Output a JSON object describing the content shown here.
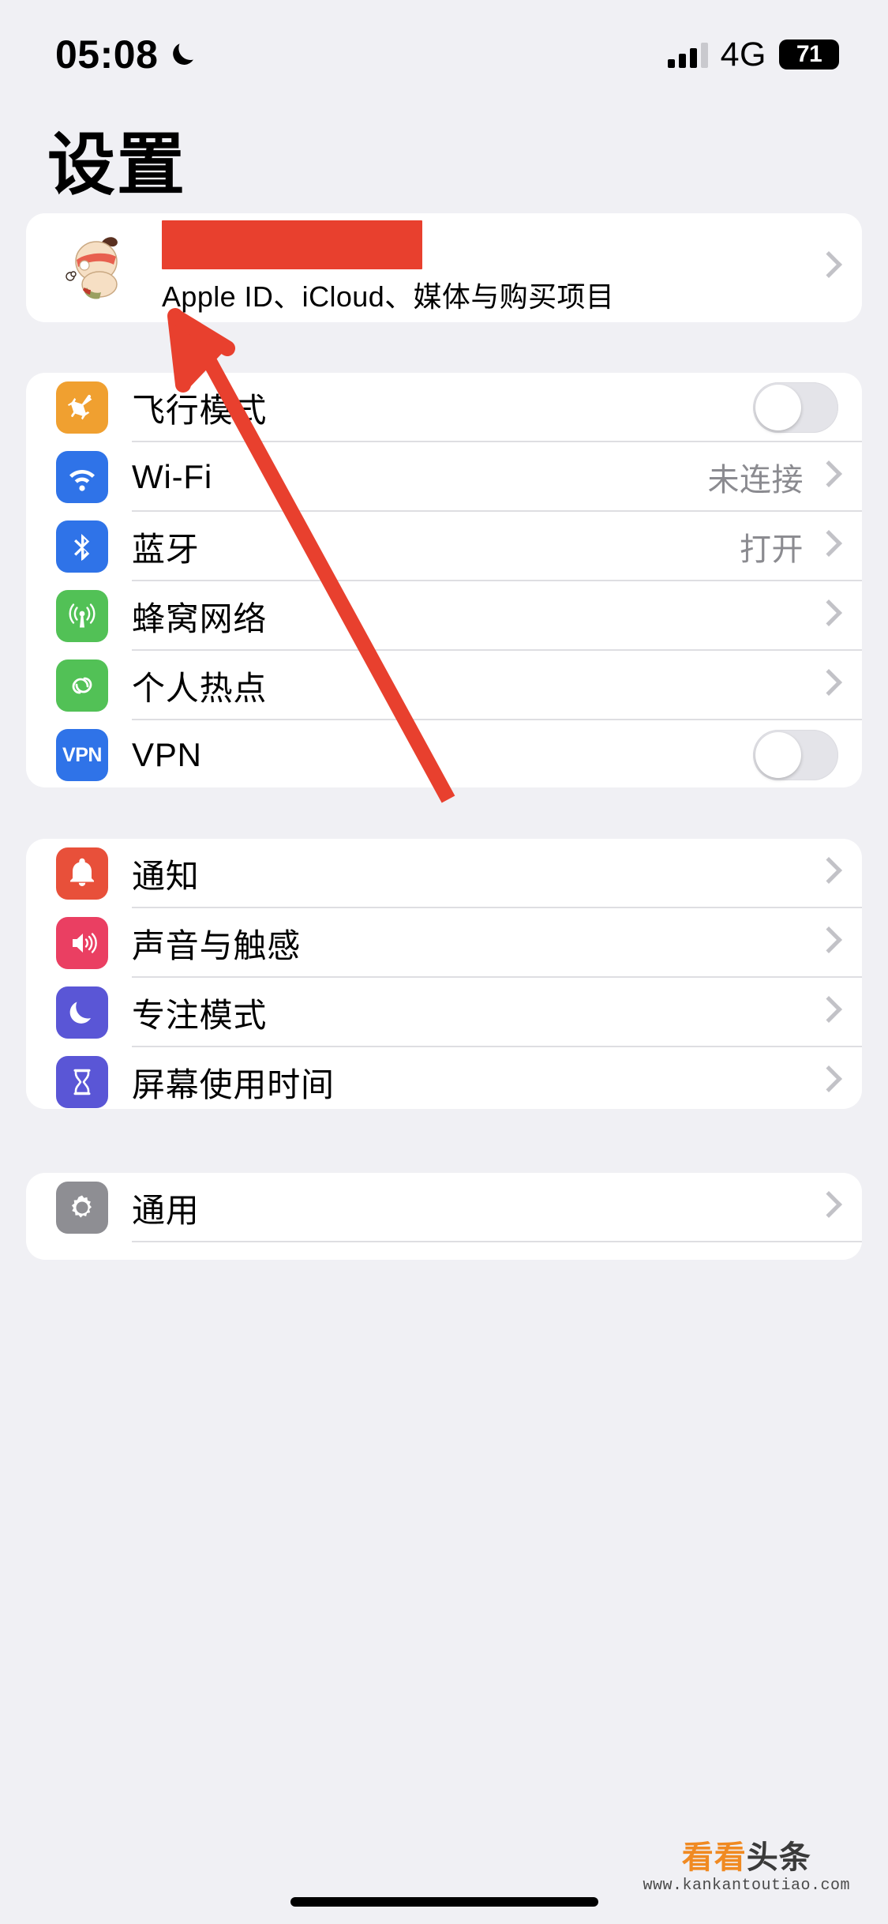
{
  "status_bar": {
    "time": "05:08",
    "dnd_icon": "crescent-moon-icon",
    "network_type": "4G",
    "battery_level": "71",
    "signal_icon": "cellular-signal-icon"
  },
  "header": {
    "title": "设置"
  },
  "account": {
    "avatar_icon": "user-avatar-cartoon",
    "name_redacted": true,
    "subtitle": "Apple ID、iCloud、媒体与购买项目",
    "chevron_icon": "chevron-right-icon"
  },
  "groups": [
    {
      "id": "connectivity",
      "rows": [
        {
          "label": "飞行模式",
          "icon": "airplane-icon",
          "icon_color": "#f0a030",
          "control": "toggle",
          "toggle_on": false,
          "value": ""
        },
        {
          "label": "Wi-Fi",
          "icon": "wifi-icon",
          "icon_color": "#2f73e8",
          "control": "chevron",
          "value": "未连接"
        },
        {
          "label": "蓝牙",
          "icon": "bluetooth-icon",
          "icon_color": "#2f73e8",
          "control": "chevron",
          "value": "打开"
        },
        {
          "label": "蜂窝网络",
          "icon": "cellular-antenna-icon",
          "icon_color": "#52c156",
          "control": "chevron",
          "value": ""
        },
        {
          "label": "个人热点",
          "icon": "hotspot-link-icon",
          "icon_color": "#52c156",
          "control": "chevron",
          "value": ""
        },
        {
          "label": "VPN",
          "icon": "vpn-icon",
          "icon_color": "#2f73e8",
          "control": "toggle",
          "toggle_on": false,
          "value": ""
        }
      ]
    },
    {
      "id": "alerts",
      "rows": [
        {
          "label": "通知",
          "icon": "bell-icon",
          "icon_color": "#e8503a",
          "control": "chevron",
          "value": ""
        },
        {
          "label": "声音与触感",
          "icon": "speaker-waves-icon",
          "icon_color": "#ea3f62",
          "control": "chevron",
          "value": ""
        },
        {
          "label": "专注模式",
          "icon": "moon-focus-icon",
          "icon_color": "#5a56d6",
          "control": "chevron",
          "value": ""
        },
        {
          "label": "屏幕使用时间",
          "icon": "hourglass-icon",
          "icon_color": "#5a56d6",
          "control": "chevron",
          "value": ""
        }
      ]
    },
    {
      "id": "system",
      "rows": [
        {
          "label": "通用",
          "icon": "gear-icon",
          "icon_color": "#8e8e93",
          "control": "chevron",
          "value": ""
        }
      ]
    }
  ],
  "annotation": {
    "type": "arrow",
    "color": "#e8402e",
    "points_to": "account-row"
  },
  "watermark": {
    "brand_orange": "看看",
    "brand_dark": "头条",
    "url": "www.kankantoutiao.com"
  },
  "colors": {
    "background": "#f0f0f4",
    "card": "#ffffff",
    "separator": "#dedee2",
    "secondary_text": "#8b8b90",
    "annotation_red": "#e8402e"
  }
}
